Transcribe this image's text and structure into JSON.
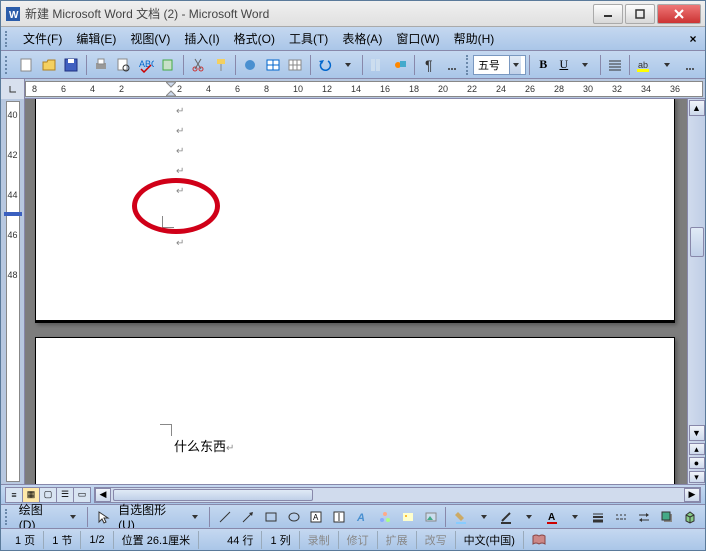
{
  "title": "新建 Microsoft Word 文档 (2) - Microsoft Word",
  "menu": {
    "file": "文件(F)",
    "edit": "编辑(E)",
    "view": "视图(V)",
    "insert": "插入(I)",
    "format": "格式(O)",
    "tools": "工具(T)",
    "table": "表格(A)",
    "window": "窗口(W)",
    "help": "帮助(H)"
  },
  "toolbar": {
    "font_size": "五号",
    "bold": "B",
    "underline": "U"
  },
  "ruler": {
    "hticks": [
      "8",
      "6",
      "4",
      "2",
      "",
      "2",
      "4",
      "6",
      "8",
      "10",
      "12",
      "14",
      "16",
      "18",
      "20",
      "22",
      "24",
      "26",
      "28",
      "30",
      "32",
      "34",
      "36"
    ]
  },
  "vruler": {
    "ticks": [
      "40",
      "42",
      "44",
      "46",
      "48"
    ]
  },
  "page2": {
    "text": "什么东西"
  },
  "drawbar": {
    "draw": "绘图(D)",
    "autoshapes": "自选图形(U)"
  },
  "status": {
    "page": "1 页",
    "sec": "1 节",
    "pages": "1/2",
    "pos": "位置 26.1厘米",
    "line": "44 行",
    "col": "1 列",
    "rec": "录制",
    "rev": "修订",
    "ext": "扩展",
    "ovr": "改写",
    "lang": "中文(中国)"
  }
}
